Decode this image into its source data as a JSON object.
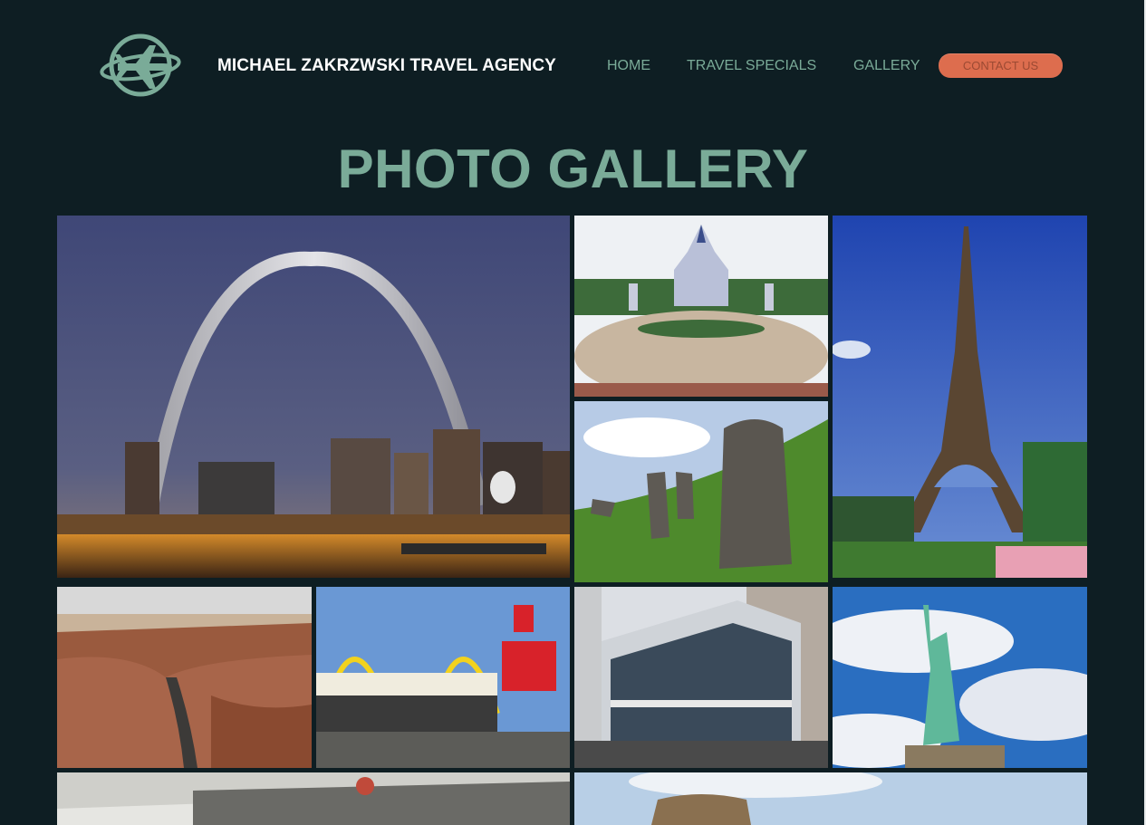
{
  "header": {
    "agency_name": "MICHAEL ZAKRZWSKI TRAVEL AGENCY",
    "logo_icon": "globe-airplane-icon"
  },
  "nav": {
    "home": "HOME",
    "specials": "TRAVEL SPECIALS",
    "gallery": "GALLERY",
    "contact": "CONTACT US"
  },
  "colors": {
    "background": "#0e1e23",
    "accent": "#7aab98",
    "contact_button": "#dd6d4e"
  },
  "gallery": {
    "title": "PHOTO GALLERY",
    "photos": [
      {
        "subject": "Gateway Arch at night"
      },
      {
        "subject": "Cinderella Castle"
      },
      {
        "subject": "Easter Island moai"
      },
      {
        "subject": "Eiffel Tower"
      },
      {
        "subject": "Grand Canyon"
      },
      {
        "subject": "Vintage McDonald's"
      },
      {
        "subject": "City storefront"
      },
      {
        "subject": "Statue of Liberty"
      },
      {
        "subject": "Aircraft hangar"
      },
      {
        "subject": "Colosseum"
      }
    ]
  }
}
